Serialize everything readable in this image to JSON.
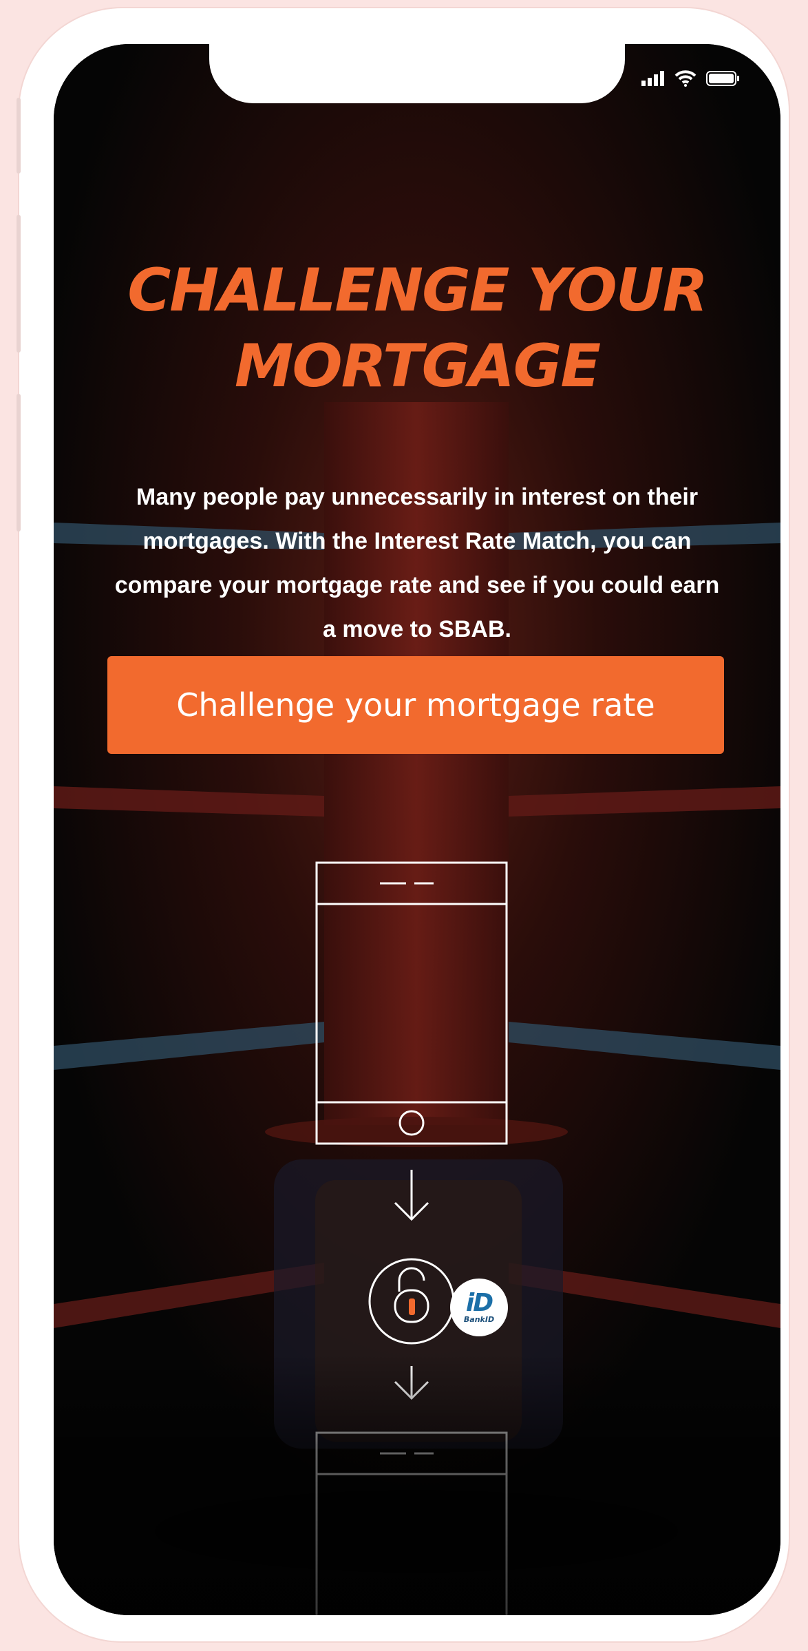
{
  "headline": {
    "line1": "CHALLENGE YOUR",
    "line2": "MORTGAGE"
  },
  "intro": {
    "text": "Many people pay unnecessarily in interest on their mortgages. With the Interest Rate Match, you can compare your mortgage rate and see if you could earn a move to SBAB."
  },
  "cta": {
    "label": "Challenge your mortgage rate"
  },
  "badge": {
    "mark": "iD",
    "text": "BankID"
  },
  "status_bar": {
    "icons": [
      "signal-icon",
      "wifi-icon",
      "battery-icon"
    ]
  },
  "colors": {
    "accent": "#f26a2e",
    "background": "#050505",
    "text": "#ffffff"
  }
}
